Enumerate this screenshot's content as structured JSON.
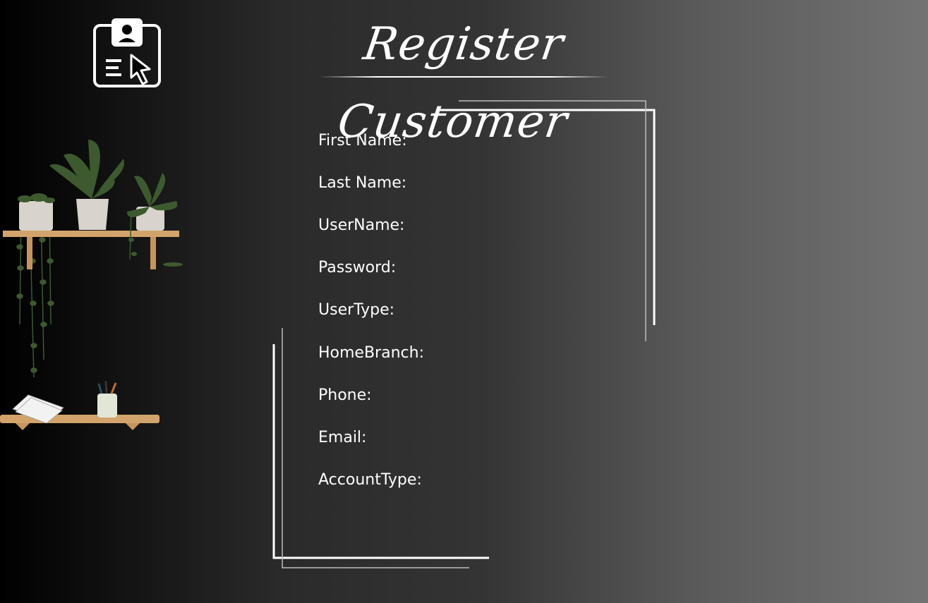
{
  "window": {
    "title": "Register Customer"
  },
  "form": {
    "fields": [
      {
        "key": "first_name",
        "label": "First Name:",
        "value": ""
      },
      {
        "key": "last_name",
        "label": "Last Name:",
        "value": ""
      },
      {
        "key": "username",
        "label": "UserName:",
        "value": ""
      },
      {
        "key": "password",
        "label": "Password:",
        "value": ""
      },
      {
        "key": "usertype",
        "label": "UserType:",
        "value": ""
      },
      {
        "key": "homebranch",
        "label": "HomeBranch:",
        "value": ""
      },
      {
        "key": "phone",
        "label": "Phone:",
        "value": ""
      },
      {
        "key": "email",
        "label": "Email:",
        "value": ""
      },
      {
        "key": "accounttype",
        "label": "AccountType:",
        "value": ""
      }
    ]
  },
  "icons": {
    "header": "register-user-icon",
    "decoration_top": "plant-shelf-illustration",
    "decoration_bottom": "desk-shelf-illustration"
  },
  "colors": {
    "text": "#ffffff",
    "frame": "#ffffff",
    "shelf_wood": "#d2a46b",
    "plant_leaf": "#3c5a2e",
    "pot": "#d8d3cc"
  }
}
